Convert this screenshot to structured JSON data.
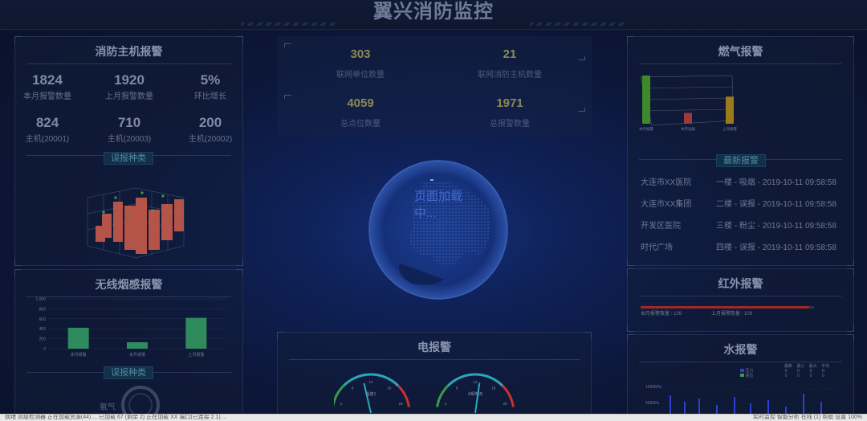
{
  "header": {
    "title": "翼兴消防监控"
  },
  "fire_host": {
    "title": "消防主机报警",
    "stats": [
      {
        "value": "1824",
        "label": "本月报警数量"
      },
      {
        "value": "1920",
        "label": "上月报警数量"
      },
      {
        "value": "5%",
        "label": "环比增长"
      },
      {
        "value": "824",
        "label": "主机(20001)"
      },
      {
        "value": "710",
        "label": "主机(20003)"
      },
      {
        "value": "200",
        "label": "主机(20002)"
      }
    ],
    "tag": "误报种类"
  },
  "smoke": {
    "title": "无线烟感报警",
    "tag": "误报种类",
    "faint_label": "氧气",
    "chart_data": {
      "type": "bar",
      "categories": [
        "本月报警",
        "本月误报",
        "上月报警"
      ],
      "values": [
        420,
        130,
        620
      ],
      "ylim": [
        0,
        1000
      ],
      "yticks": [
        "0",
        "200",
        "400",
        "600",
        "800",
        "1,000"
      ],
      "color": "#2f8a5c"
    }
  },
  "center": {
    "stats": [
      {
        "value": "303",
        "label": "联网单位数量"
      },
      {
        "value": "21",
        "label": "联网消防主机数量"
      },
      {
        "value": "4059",
        "label": "总点位数量"
      },
      {
        "value": "1971",
        "label": "总报警数量"
      }
    ],
    "loading_dash": "-",
    "loading_text": "页面加载中...",
    "electric": {
      "title": "电报警",
      "gauges": [
        {
          "name": "温度1",
          "value": 42,
          "max": 100
        },
        {
          "name": "A相电流",
          "value": 55,
          "max": 100
        }
      ],
      "scale_labels": [
        "4",
        "8",
        "12",
        "16",
        "20"
      ]
    }
  },
  "gas": {
    "title": "燃气报警",
    "chart_data": {
      "type": "bar",
      "categories": [
        "本月报警",
        "本月误报",
        "上月报警"
      ],
      "values": [
        80,
        18,
        45
      ],
      "colors": [
        "#3e8a2a",
        "#9a3a3a",
        "#9a7a1a"
      ]
    },
    "tag": "最新报警",
    "alarms": [
      {
        "location": "大连市XX医院",
        "info": "一楼 - 吸烟 - 2019-10-11 09:58:58"
      },
      {
        "location": "大连市XX集团",
        "info": "二楼 - 误报 - 2019-10-11 09:58:58"
      },
      {
        "location": "开发区医院",
        "info": "三楼 - 粉尘 - 2019-10-11 09:58:58"
      },
      {
        "location": "时代广场",
        "info": "四楼 - 误报 - 2019-10-11 09:58:58"
      }
    ]
  },
  "infrared": {
    "title": "红外报警",
    "chart_data": {
      "type": "bar",
      "series": [
        {
          "name": "本月报警数量",
          "value": 109
        },
        {
          "name": "上月报警数量",
          "value": 109
        }
      ],
      "bar_fill": 0.97,
      "color": "#a02828"
    }
  },
  "water": {
    "title": "水报警",
    "legend": [
      "压力",
      "液位"
    ],
    "columns": [
      "最新",
      "最小",
      "最大",
      "平均"
    ],
    "rows": [
      [
        "0",
        "0",
        "0",
        "0"
      ],
      [
        "0",
        "0",
        "0",
        "0"
      ]
    ],
    "axis_label": "1000kPa",
    "axis_label2": "500kPa"
  },
  "statusbar": {
    "left": "就绪    高级检测器    正在加载资源(44) ... 已加载 67 (剩余 2) 正在加载 XX 端口(已连接 2.1) ...",
    "right": "实时监控    智能分析    在线 (1)    帮助    设置    100%"
  }
}
